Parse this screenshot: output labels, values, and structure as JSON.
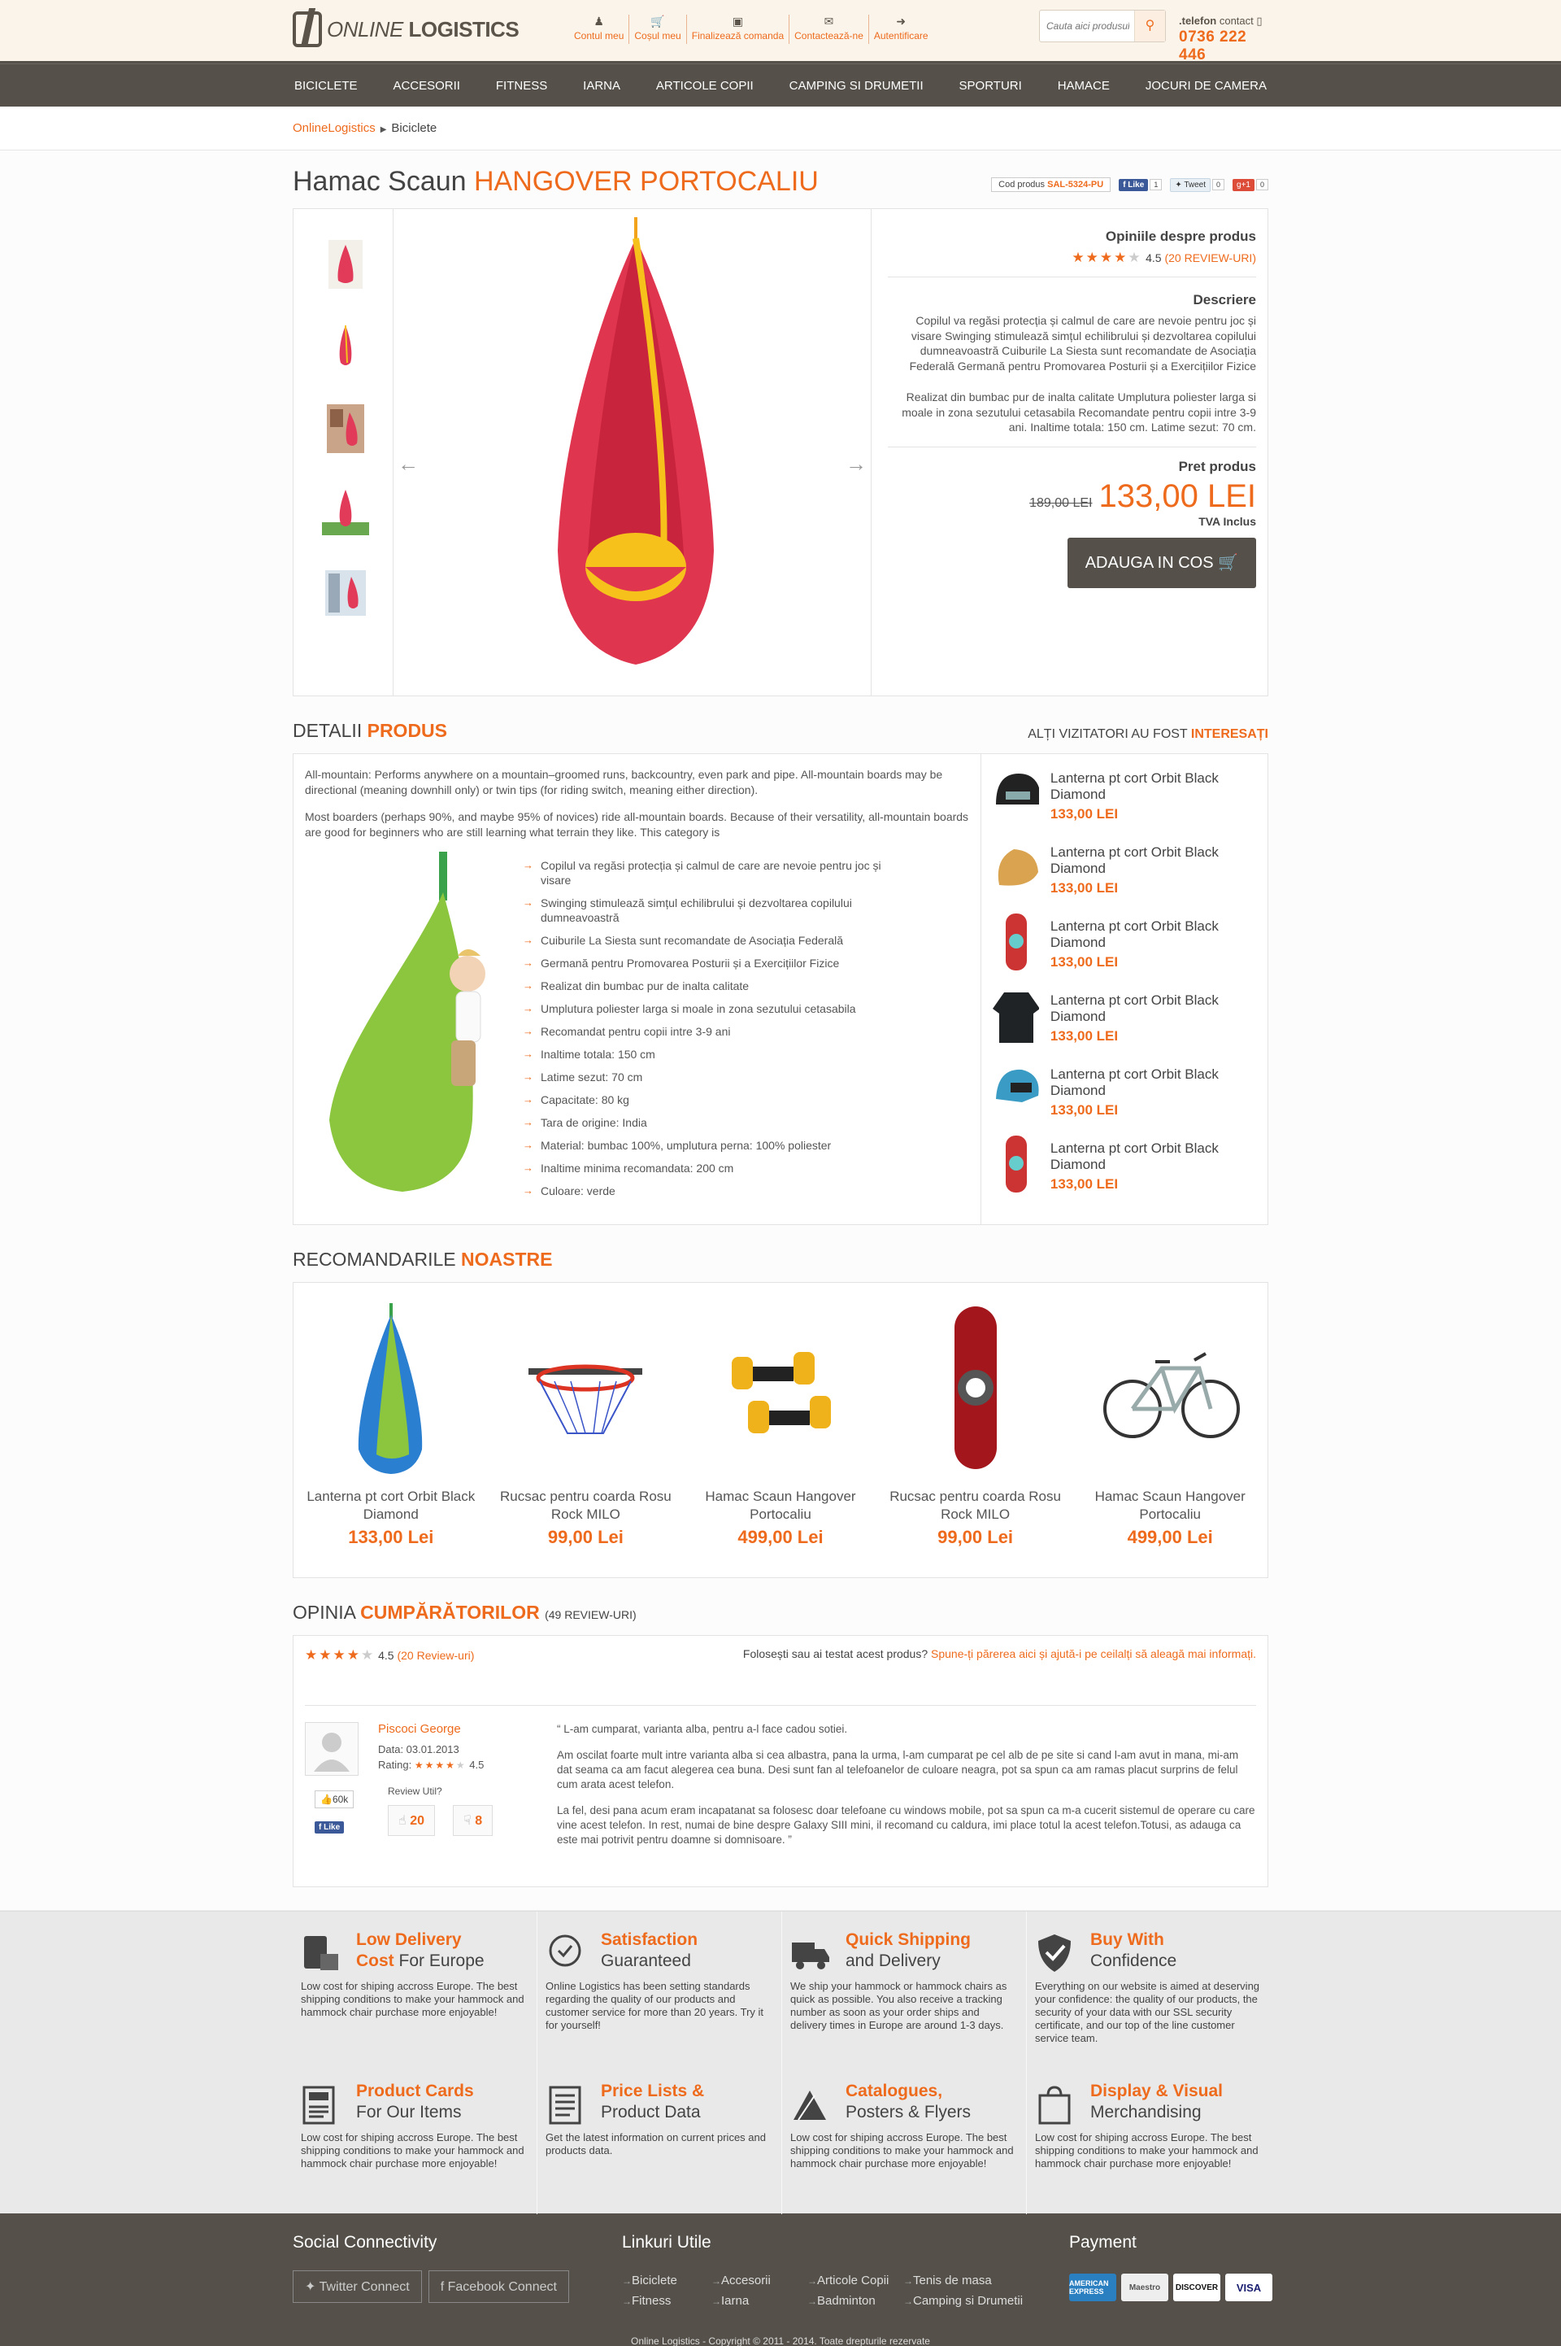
{
  "header": {
    "logo_prefix": "ONLINE",
    "logo_suffix": "LOGISTICS",
    "topnav": [
      "Contul meu",
      "Coșul meu",
      "Finalizează comanda",
      "Contactează-ne",
      "Autentificare"
    ],
    "search_placeholder": "Cauta aici produsul...",
    "phone_label_a": ".telefon",
    "phone_label_b": " contact",
    "phone_number": "0736 222 446"
  },
  "nav": [
    "BICICLETE",
    "ACCESORII",
    "FITNESS",
    "IARNA",
    "ARTICOLE COPII",
    "CAMPING SI DRUMETII",
    "SPORTURI",
    "HAMACE",
    "JOCURI DE CAMERA"
  ],
  "breadcrumb": {
    "root": "OnlineLogistics",
    "current": "Biciclete"
  },
  "product": {
    "title_a": "Hamac Scaun",
    "title_b": "HANGOVER PORTOCALIU",
    "code_label": "Cod produs",
    "code": "SAL-5324-PU",
    "fb_label": "Like",
    "fb_count": "1",
    "tw_label": "Tweet",
    "tw_count": "0",
    "gp_label": "+1",
    "gp_count": "0",
    "opinions_title": "Opiniile despre produs",
    "rating": "4.5",
    "reviews_link": "(20 REVIEW-URI)",
    "desc_title": "Descriere",
    "desc_1": "Copilul va regăsi protecția și calmul de care are nevoie pentru joc și visare Swinging stimulează simțul echilibrului și dezvoltarea copilului dumneavoastră Cuiburile La Siesta sunt recomandate de Asociația Federală Germană pentru Promovarea Posturii și a Exercițiilor Fizice",
    "desc_2": "Realizat din bumbac pur de inalta calitate Umplutura poliester larga si moale in zona sezutului cetasabila Recomandate pentru copii intre 3-9 ani. Inaltime totala: 150 cm. Latime sezut: 70 cm.",
    "price_title": "Pret produs",
    "price_old": "189,00 LEI",
    "price_new": "133,00 LEI",
    "vat": "TVA Inclus",
    "cart_btn": "ADAUGA IN COS"
  },
  "details": {
    "title_a": "DETALII",
    "title_b": "PRODUS",
    "others_a": "ALȚI VIZITATORI AU FOST",
    "others_b": "INTERESAȚI",
    "p1": "All-mountain: Performs anywhere on a mountain–groomed runs, backcountry, even park and pipe. All-mountain boards may be directional (meaning downhill only) or twin tips (for riding switch, meaning either direction).",
    "p2": "Most boarders (perhaps 90%, and maybe 95% of novices) ride all-mountain boards. Because of their versatility, all-mountain boards are good for beginners who are still learning what terrain they like. This category is",
    "bullets": [
      "Copilul va regăsi protecția și calmul de care are nevoie pentru joc și visare",
      "Swinging stimulează simțul echilibrului și dezvoltarea copilului dumneavoastră",
      "Cuiburile La Siesta sunt recomandate de Asociația Federală",
      "Germană pentru Promovarea Posturii și a Exercițiilor Fizice",
      "Realizat din bumbac pur de inalta calitate",
      "Umplutura poliester larga si moale in zona sezutului cetasabila",
      "Recomandat pentru copii intre 3-9 ani",
      "Inaltime totala: 150 cm",
      "Latime sezut: 70 cm",
      "Capacitate: 80 kg",
      "Tara de origine: India",
      "Material: bumbac 100%, umplutura perna: 100% poliester",
      "Inaltime minima recomandata: 200 cm",
      "Culoare: verde"
    ],
    "others": [
      {
        "name": "Lanterna pt cort Orbit Black Diamond",
        "price": "133,00 LEI"
      },
      {
        "name": "Lanterna pt cort Orbit Black Diamond",
        "price": "133,00 LEI"
      },
      {
        "name": "Lanterna pt cort Orbit Black Diamond",
        "price": "133,00 LEI"
      },
      {
        "name": "Lanterna pt cort Orbit Black Diamond",
        "price": "133,00 LEI"
      },
      {
        "name": "Lanterna pt cort Orbit Black Diamond",
        "price": "133,00 LEI"
      },
      {
        "name": "Lanterna pt cort Orbit Black Diamond",
        "price": "133,00 LEI"
      }
    ]
  },
  "recommend": {
    "title_a": "RECOMANDARILE",
    "title_b": "NOASTRE",
    "items": [
      {
        "name": "Lanterna pt cort Orbit Black Diamond",
        "price": "133,00 Lei"
      },
      {
        "name": "Rucsac pentru coarda Rosu Rock MILO",
        "price": "99,00 Lei"
      },
      {
        "name": "Hamac Scaun Hangover Portocaliu",
        "price": "499,00 Lei"
      },
      {
        "name": "Rucsac pentru coarda Rosu Rock MILO",
        "price": "99,00 Lei"
      },
      {
        "name": "Hamac Scaun Hangover Portocaliu",
        "price": "499,00 Lei"
      }
    ]
  },
  "opinions": {
    "title_a": "OPINIA",
    "title_b": "CUMPĂRĂTORILOR",
    "title_count": "(49 REVIEW-URI)",
    "rating": "4.5",
    "reviews_link": "(20 Review-uri)",
    "prompt": "Folosești sau ai testat acest produs?",
    "prompt_link": "Spune-ți părerea aici și ajută-i pe ceilalți să aleagă mai informați.",
    "review": {
      "author": "Piscoci George",
      "date": "Data: 03.01.2013",
      "rating_label": "Rating:",
      "rating": "4.5",
      "likes": "60k",
      "like_label": "Like",
      "useful_label": "Review Util?",
      "up": "20",
      "down": "8",
      "p1": "“ L-am cumparat, varianta alba, pentru a-l face cadou sotiei.",
      "p2": "Am oscilat foarte mult intre varianta alba si cea albastra, pana la urma, l-am cumparat pe cel alb de pe site si cand l-am avut in mana, mi-am dat seama ca am facut alegerea cea buna. Desi sunt fan al telefoanelor de culoare neagra, pot sa spun ca am ramas placut surprins de felul cum arata acest telefon.",
      "p3": "La fel, desi pana acum eram incapatanat sa folosesc doar telefoane cu windows mobile, pot sa spun ca m-a cucerit sistemul de operare cu care vine acest telefon. In rest, numai de bine despre Galaxy SIII mini, il recomand cu caldura, imi place totul la acest telefon.Totusi, as adauga ca este mai potrivit pentru doamne si domnisoare. ”"
    }
  },
  "features": [
    {
      "icon": "phone-delivery-icon",
      "h1": "Low Delivery",
      "h2a": "Cost",
      "h2b": " For Europe",
      "desc": "Low cost for shiping accross Europe. The best shipping conditions to make your hammock and hammock chair purchase more enjoyable!"
    },
    {
      "icon": "badge-icon",
      "h1": "Satisfaction",
      "h2a": "",
      "h2b": "Guaranteed",
      "desc": "Online Logistics has been setting standards regarding the quality of our products and customer service for more than 20 years. Try it for yourself!"
    },
    {
      "icon": "truck-icon",
      "h1": "Quick Shipping",
      "h2a": "",
      "h2b": "and Delivery",
      "desc": "We ship your hammock or hammock chairs as quick as possible. You also receive a tracking number as soon as your order ships and delivery times in Europe are around 1-3 days."
    },
    {
      "icon": "shield-icon",
      "h1": "Buy With",
      "h2a": "",
      "h2b": "Confidence",
      "desc": "Everything on our website is aimed at deserving your confidence: the quality of our products, the security of your data with our SSL security certificate, and our top of the line customer service team."
    },
    {
      "icon": "product-card-icon",
      "h1": "Product Cards",
      "h2a": "",
      "h2b": "For Our Items",
      "desc": "Low cost for shiping accross Europe. The best shipping conditions to make your hammock and hammock chair purchase more enjoyable!"
    },
    {
      "icon": "price-list-icon",
      "h1": "Price Lists &",
      "h2a": "",
      "h2b": "Product Data",
      "desc": "Get the latest information on current prices and products data."
    },
    {
      "icon": "catalog-icon",
      "h1": "Catalogues,",
      "h2a": "",
      "h2b": "Posters & Flyers",
      "desc": "Low cost for shiping accross Europe. The best shipping conditions to make your hammock and hammock chair purchase more enjoyable!"
    },
    {
      "icon": "bag-icon",
      "h1": "Display & Visual",
      "h2a": "",
      "h2b": "Merchandising",
      "desc": "Low cost for shiping accross Europe. The best shipping conditions to make your hammock and hammock chair purchase more enjoyable!"
    }
  ],
  "footer": {
    "social_title": "Social Connectivity",
    "twitter": "Twitter Connect",
    "facebook": "Facebook Connect",
    "links_title": "Linkuri Utile",
    "links": [
      "Biciclete",
      "Accesorii",
      "Articole Copii",
      "Tenis de masa",
      "Fitness",
      "Iarna",
      "Badminton",
      "Camping si Drumetii"
    ],
    "payment_title": "Payment",
    "payments": [
      "AMERICAN EXPRESS",
      "Maestro",
      "DISCOVER",
      "VISA"
    ],
    "copyright": "Online Logistics - Copyright © 2011 - 2014. Toate drepturile rezervate"
  },
  "colors": {
    "accent": "#ee6b1d",
    "dark": "#55514a",
    "cream": "#faf4ea"
  }
}
